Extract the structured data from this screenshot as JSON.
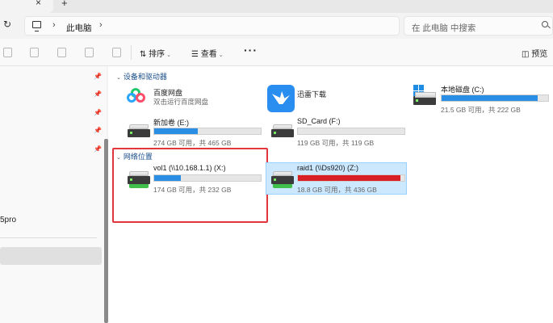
{
  "window": {
    "tab_close_glyph": "×",
    "tab_add_glyph": "+"
  },
  "address": {
    "crumb": "此电脑",
    "sep": "›"
  },
  "search": {
    "placeholder": "在 此电脑 中搜索"
  },
  "toolbar": {
    "sort_label": "排序",
    "view_label": "查看",
    "more_label": "···",
    "preview_label": "预览"
  },
  "nav": {
    "visible_text": "5pro"
  },
  "groups": {
    "devices_header": "设备和驱动器",
    "network_header": "网络位置"
  },
  "devices": [
    {
      "name": "百度网盘",
      "sub": "双击运行百度网盘"
    },
    {
      "name": "迅雷下载"
    },
    {
      "name": "本地磁盘 (C:)",
      "free": "21.5 GB 可用，共 222 GB",
      "used_fraction": 0.9,
      "color": "#2a8ee5"
    },
    {
      "name": "新加卷 (E:)",
      "free": "274 GB 可用，共 465 GB",
      "used_fraction": 0.41,
      "color": "#2a8ee5"
    },
    {
      "name": "SD_Card (F:)",
      "free": "119 GB 可用，共 119 GB",
      "used_fraction": 0.0,
      "color": "#2a8ee5"
    }
  ],
  "network": [
    {
      "name": "vol1 (\\\\10.168.1.1) (X:)",
      "free": "174 GB 可用，共 232 GB",
      "used_fraction": 0.25,
      "color": "#2a8ee5"
    },
    {
      "name": "raid1 (\\\\Ds920) (Z:)",
      "free": "18.8 GB 可用，共 436 GB",
      "used_fraction": 0.96,
      "color": "#d81f26"
    }
  ]
}
